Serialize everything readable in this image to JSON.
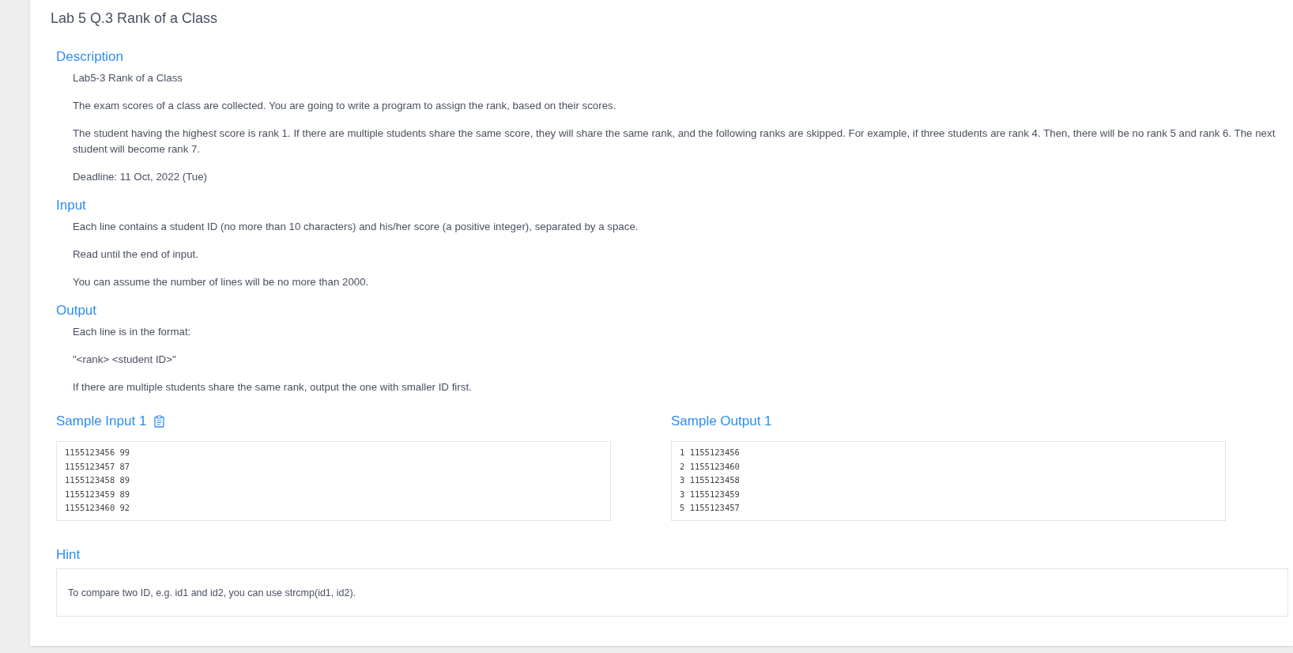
{
  "title": "Lab 5 Q.3 Rank of a Class",
  "sections": [
    {
      "heading": "Description",
      "paragraphs": [
        "Lab5-3 Rank of a Class",
        "The exam scores of a class are collected. You are going to write a program to assign the rank, based on their scores.",
        "The student having the highest score is rank 1. If there are multiple students share the same score, they will share the same rank, and the following ranks are skipped. For example, if three students are rank 4. Then, there will be no rank 5 and rank 6. The next student will become rank 7.",
        "Deadline: 11 Oct, 2022 (Tue)"
      ]
    },
    {
      "heading": "Input",
      "paragraphs": [
        "Each line contains a student ID (no more than 10 characters) and his/her score (a positive integer), separated by a space.",
        "Read until the end of input.",
        "You can assume the number of lines will be no more than 2000."
      ]
    },
    {
      "heading": "Output",
      "paragraphs": [
        "Each line is in the format:",
        "\"<rank> <student ID>\"",
        "If there are multiple students share the same rank, output the one with smaller ID first."
      ]
    }
  ],
  "samples": [
    {
      "heading": "Sample Input 1",
      "copy_icon": true,
      "lines": [
        "1155123456 99",
        "1155123457 87",
        "1155123458 89",
        "1155123459 89",
        "1155123460 92"
      ]
    },
    {
      "heading": "Sample Output 1",
      "copy_icon": false,
      "lines": [
        "1 1155123456",
        "2 1155123460",
        "3 1155123458",
        "3 1155123459",
        "5 1155123457"
      ]
    }
  ],
  "hint": {
    "heading": "Hint",
    "text": "To compare two ID, e.g. id1 and id2, you can use strcmp(id1, id2)."
  }
}
